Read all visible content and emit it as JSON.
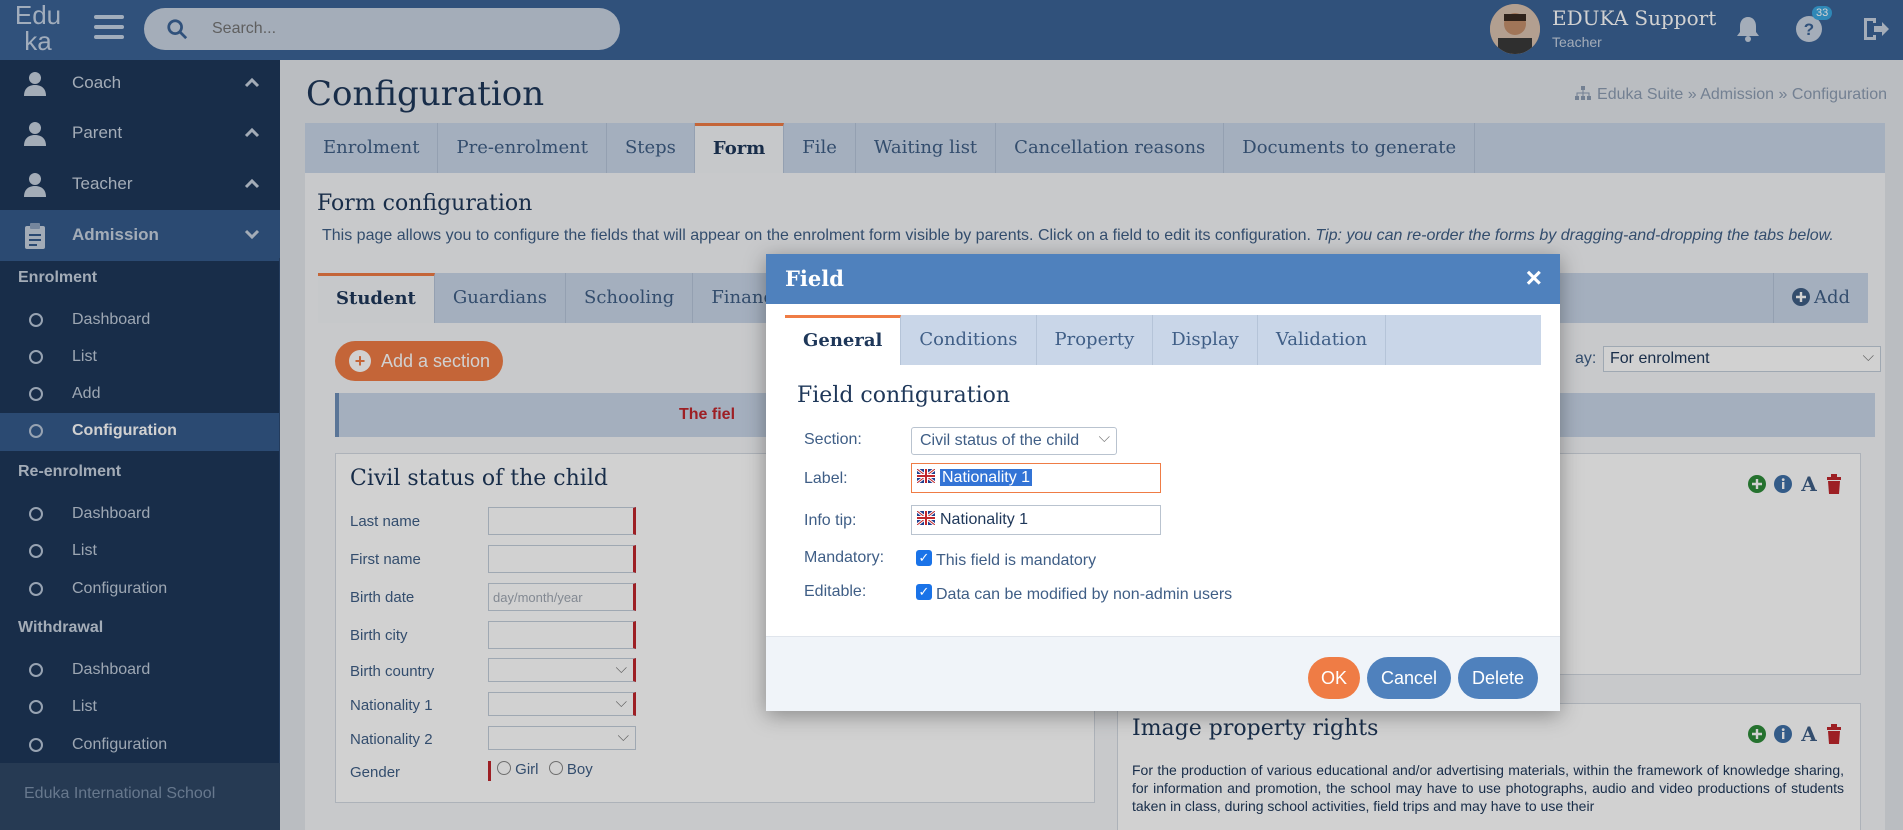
{
  "header": {
    "logo_line1": "Edu",
    "logo_line2": "ka",
    "search_placeholder": "Search...",
    "user_name": "EDUKA Support",
    "user_role": "Teacher",
    "help_badge": "33"
  },
  "sidebar": {
    "roles": [
      "Coach",
      "Parent",
      "Teacher",
      "Admission"
    ],
    "sections": [
      {
        "title": "Enrolment",
        "items": [
          "Dashboard",
          "List",
          "Add",
          "Configuration"
        ]
      },
      {
        "title": "Re-enrolment",
        "items": [
          "Dashboard",
          "List",
          "Configuration"
        ]
      },
      {
        "title": "Withdrawal",
        "items": [
          "Dashboard",
          "List",
          "Configuration"
        ]
      }
    ],
    "footer": "Eduka International School"
  },
  "page": {
    "title": "Configuration",
    "breadcrumb": "Eduka Suite » Admission » Configuration",
    "tabs": [
      "Enrolment",
      "Pre-enrolment",
      "Steps",
      "Form",
      "File",
      "Waiting list",
      "Cancellation reasons",
      "Documents to generate"
    ],
    "active_tab": "Form"
  },
  "form_config": {
    "title": "Form configuration",
    "description": "This page allows you to configure the fields that will appear on the enrolment form visible by parents. Click on a field to edit its configuration.",
    "tip": "Tip: you can re-order the forms by dragging-and-dropping the tabs below.",
    "subtabs": [
      "Student",
      "Guardians",
      "Schooling",
      "Finance"
    ],
    "add_tab": "Add",
    "add_section": "Add a section",
    "display_label": "ay:",
    "display_value": "For enrolment",
    "warning_partial": "The fiel"
  },
  "card_civil": {
    "title": "Civil status of the child",
    "fields": [
      "Last name",
      "First name",
      "Birth date",
      "Birth city",
      "Birth country",
      "Nationality 1",
      "Nationality 2",
      "Gender"
    ],
    "birth_date_placeholder": "day/month/year",
    "gender_options": [
      "Girl",
      "Boy"
    ]
  },
  "card_image": {
    "title": "Image property rights",
    "text": "For the production of various educational and/or advertising materials, within the framework of knowledge sharing, for information and promotion, the school may have to use photographs, audio and video productions of students taken in class, during school activities, field trips and may have to use their"
  },
  "modal": {
    "title": "Field",
    "close": "×",
    "tabs": [
      "General",
      "Conditions",
      "Property",
      "Display",
      "Validation"
    ],
    "section_title": "Field configuration",
    "section_label": "Section:",
    "section_value": "Civil status of the child",
    "label_label": "Label:",
    "label_value": "Nationality 1",
    "infotip_label": "Info tip:",
    "infotip_value": "Nationality 1",
    "mandatory_label": "Mandatory:",
    "mandatory_text": "This field is mandatory",
    "editable_label": "Editable:",
    "editable_text": "Data can be modified by non-admin users",
    "ok": "OK",
    "cancel": "Cancel",
    "delete": "Delete"
  },
  "colors": {
    "accent": "#ef7c45",
    "primary": "#4f81bd",
    "sidebar": "#1e3759"
  }
}
